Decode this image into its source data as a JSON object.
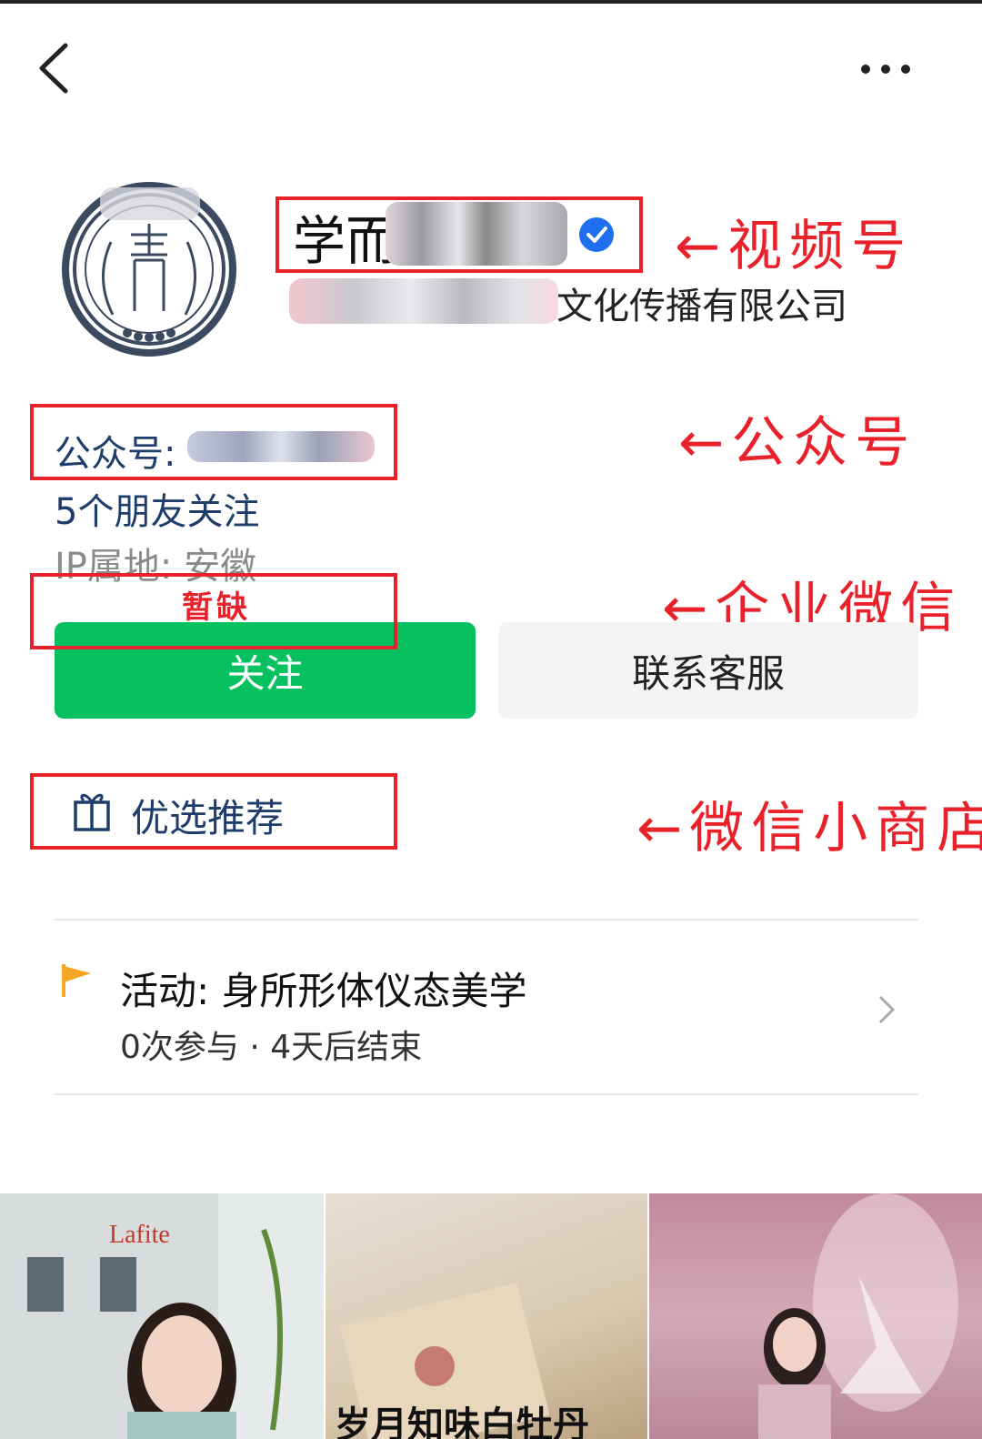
{
  "header": {
    "back_icon": "chevron-left-icon",
    "more_icon": "more-dots-icon"
  },
  "profile": {
    "name_visible": "学而",
    "company_suffix": "文化传播有限公司",
    "verified_icon": "verified-badge-icon"
  },
  "info": {
    "gzh_label": "公众号:",
    "friends": "5个朋友关注",
    "ip": "IP属地: 安徽",
    "wecom_value": "暂缺"
  },
  "buttons": {
    "follow": "关注",
    "contact": "联系客服"
  },
  "shop": {
    "label": "优选推荐",
    "icon": "gift-box-icon"
  },
  "activity": {
    "title": "活动: 身所形体仪态美学",
    "meta": "0次参与 · 4天后结束",
    "icon": "flag-icon"
  },
  "annotations": {
    "video": "←视频号",
    "gzh": "←公众号",
    "wecom": "←企业微信",
    "shop": "←微信小商店"
  },
  "thumbnails": {
    "second_caption": "岁月知味白牡丹"
  },
  "colors": {
    "accent_green": "#07c160",
    "annotation_red": "#e8212a",
    "link_navy": "#1f3d6b",
    "verify_blue": "#1e6ff0"
  }
}
